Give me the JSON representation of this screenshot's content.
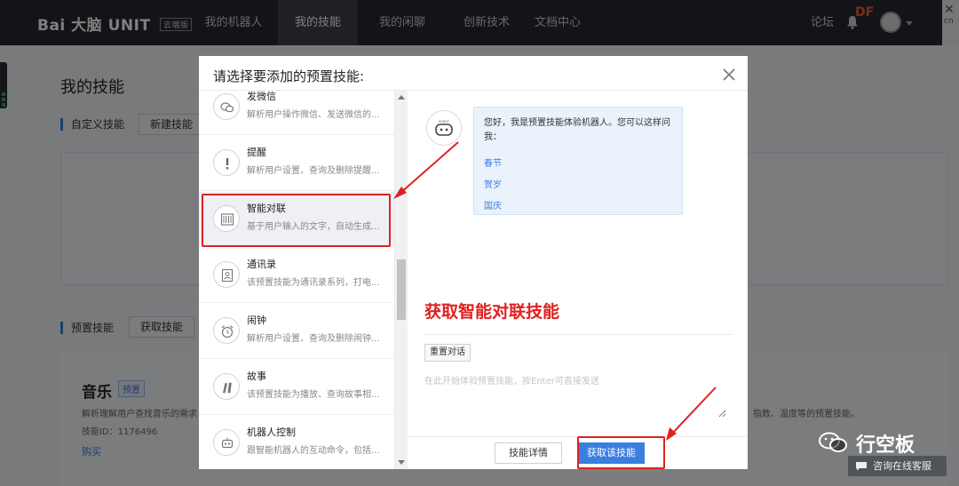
{
  "topbar": {
    "logo": "Bai 大脑 UNIT",
    "logo_badge": "云端版",
    "nav": [
      "我的机器人",
      "我的技能",
      "我的闲聊",
      "创新技术",
      "文档中心"
    ],
    "active_nav": "我的技能",
    "forum": "论坛",
    "df_mark": "DF",
    "corner_text": "cn"
  },
  "page": {
    "title": "我的技能",
    "custom_section": "自定义技能",
    "new_skill_button": "新建技能",
    "preset_section": "预置技能",
    "get_skill_button": "获取技能",
    "music_card": {
      "title": "音乐",
      "badge": "预置",
      "desc_left": "解析理解用户查找音乐的需求",
      "desc_right": "指数、温度等的预置技能。",
      "skill_id": "技能ID：1176496",
      "buy": "购买"
    }
  },
  "modal": {
    "title": "请选择要添加的预置技能:",
    "skills": [
      {
        "name": "发微信",
        "desc": "解析用户操作微信、发送微信的..."
      },
      {
        "name": "提醒",
        "desc": "解析用户设置、查询及删除提醒..."
      },
      {
        "name": "智能对联",
        "desc": "基于用户输入的文字，自动生成..."
      },
      {
        "name": "通讯录",
        "desc": "该预置技能为通讯录系列，打电..."
      },
      {
        "name": "闹钟",
        "desc": "解析用户设置、查询及删除闹钟..."
      },
      {
        "name": "故事",
        "desc": "该预置技能为播放、查询故事相..."
      },
      {
        "name": "机器人控制",
        "desc": "跟智能机器人的互动命令，包括..."
      }
    ],
    "robot_label": "ROBOT",
    "bubble_text": "您好，我是预置技能体验机器人。您可以这样问我：",
    "bubble_links": [
      "春节",
      "贺岁",
      "国庆"
    ],
    "annotation": "获取智能对联技能",
    "reset_button": "重置对话",
    "input_placeholder": "在此开始体验预置技能，按Enter可直接发送",
    "detail_button": "技能详情",
    "get_button": "获取该技能"
  },
  "watermark": {
    "brand": "行空板",
    "consult": "咨询在线客服"
  },
  "colors": {
    "accent": "#3a7ee0",
    "annotation_red": "#e02020",
    "topbar_bg": "#26292e"
  }
}
